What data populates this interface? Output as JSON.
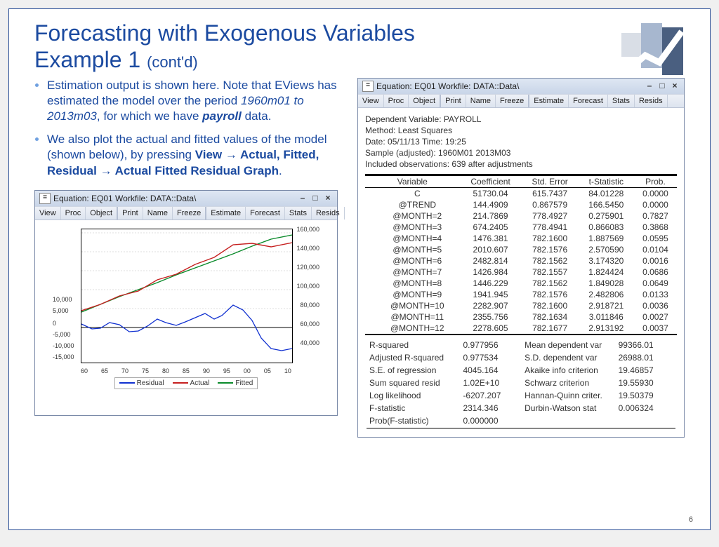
{
  "title_line1": "Forecasting with Exogenous Variables",
  "title_line2": "Example 1",
  "title_contd": "(cont'd)",
  "page_number": "6",
  "bullets": {
    "b1a": "Estimation output is shown here. Note that EViews has estimated the model over the period ",
    "b1b": "1960m01 to 2013m03",
    "b1c": ", for which we have ",
    "b1d": "payroll",
    "b1e": " data.",
    "b2a": "We also plot the actual and fitted values of the model (shown below), by pressing ",
    "b2b": "View → Actual, Fitted, Residual → Actual Fitted Residual Graph",
    "b2c": "."
  },
  "ev_titlebar": "Equation: EQ01   Workfile: DATA::Data\\",
  "toolbar": [
    "View",
    "Proc",
    "Object",
    "Print",
    "Name",
    "Freeze",
    "Estimate",
    "Forecast",
    "Stats",
    "Resids"
  ],
  "reg_meta": {
    "l1": "Dependent Variable: PAYROLL",
    "l2": "Method: Least Squares",
    "l3": "Date: 05/11/13   Time: 19:25",
    "l4": "Sample (adjusted): 1960M01 2013M03",
    "l5": "Included observations: 639 after adjustments"
  },
  "reg_headers": [
    "Variable",
    "Coefficient",
    "Std. Error",
    "t-Statistic",
    "Prob."
  ],
  "reg_rows": [
    [
      "C",
      "51730.04",
      "615.7437",
      "84.01228",
      "0.0000"
    ],
    [
      "@TREND",
      "144.4909",
      "0.867579",
      "166.5450",
      "0.0000"
    ],
    [
      "@MONTH=2",
      "214.7869",
      "778.4927",
      "0.275901",
      "0.7827"
    ],
    [
      "@MONTH=3",
      "674.2405",
      "778.4941",
      "0.866083",
      "0.3868"
    ],
    [
      "@MONTH=4",
      "1476.381",
      "782.1600",
      "1.887569",
      "0.0595"
    ],
    [
      "@MONTH=5",
      "2010.607",
      "782.1576",
      "2.570590",
      "0.0104"
    ],
    [
      "@MONTH=6",
      "2482.814",
      "782.1562",
      "3.174320",
      "0.0016"
    ],
    [
      "@MONTH=7",
      "1426.984",
      "782.1557",
      "1.824424",
      "0.0686"
    ],
    [
      "@MONTH=8",
      "1446.229",
      "782.1562",
      "1.849028",
      "0.0649"
    ],
    [
      "@MONTH=9",
      "1941.945",
      "782.1576",
      "2.482806",
      "0.0133"
    ],
    [
      "@MONTH=10",
      "2282.907",
      "782.1600",
      "2.918721",
      "0.0036"
    ],
    [
      "@MONTH=11",
      "2355.756",
      "782.1634",
      "3.011846",
      "0.0027"
    ],
    [
      "@MONTH=12",
      "2278.605",
      "782.1677",
      "2.913192",
      "0.0037"
    ]
  ],
  "stats_left": [
    [
      "R-squared",
      "0.977956"
    ],
    [
      "Adjusted R-squared",
      "0.977534"
    ],
    [
      "S.E. of regression",
      "4045.164"
    ],
    [
      "Sum squared resid",
      "1.02E+10"
    ],
    [
      "Log likelihood",
      "-6207.207"
    ],
    [
      "F-statistic",
      "2314.346"
    ],
    [
      "Prob(F-statistic)",
      "0.000000"
    ]
  ],
  "stats_right": [
    [
      "Mean dependent var",
      "99366.01"
    ],
    [
      "S.D. dependent var",
      "26988.01"
    ],
    [
      "Akaike info criterion",
      "19.46857"
    ],
    [
      "Schwarz criterion",
      "19.55930"
    ],
    [
      "Hannan-Quinn criter.",
      "19.50379"
    ],
    [
      "Durbin-Watson stat",
      "0.006324"
    ],
    [
      "",
      ""
    ]
  ],
  "legend": {
    "residual": "Residual",
    "actual": "Actual",
    "fitted": "Fitted"
  },
  "chart_data": [
    {
      "type": "line",
      "title": "Actual vs Fitted (PAYROLL) and Residual",
      "x_ticks": [
        "60",
        "65",
        "70",
        "75",
        "80",
        "85",
        "90",
        "95",
        "00",
        "05",
        "10"
      ],
      "right_axis": {
        "label": "",
        "ticks": [
          40000,
          60000,
          80000,
          100000,
          120000,
          140000,
          160000
        ]
      },
      "left_axis": {
        "label": "",
        "ticks": [
          -15000,
          -10000,
          -5000,
          0,
          5000,
          10000
        ]
      },
      "series": [
        {
          "name": "Actual",
          "axis": "right",
          "x": [
            1960,
            1965,
            1970,
            1975,
            1980,
            1985,
            1990,
            1995,
            2000,
            2005,
            2010,
            2013
          ],
          "y": [
            54000,
            61000,
            71000,
            77000,
            91000,
            97000,
            109000,
            117000,
            132000,
            134000,
            130000,
            135000
          ]
        },
        {
          "name": "Fitted",
          "axis": "right",
          "x": [
            1960,
            1965,
            1970,
            1975,
            1980,
            1985,
            1990,
            1995,
            2000,
            2005,
            2010,
            2013
          ],
          "y": [
            52500,
            61200,
            69900,
            78600,
            87300,
            96000,
            104700,
            113400,
            122100,
            130800,
            139500,
            144300
          ]
        },
        {
          "name": "Residual",
          "axis": "left",
          "x": [
            1960,
            1965,
            1970,
            1975,
            1980,
            1985,
            1990,
            1995,
            2000,
            2005,
            2010,
            2013
          ],
          "y": [
            1500,
            -200,
            1100,
            -1600,
            3700,
            1000,
            4300,
            3600,
            9900,
            3200,
            -9500,
            -9300
          ]
        }
      ]
    }
  ]
}
